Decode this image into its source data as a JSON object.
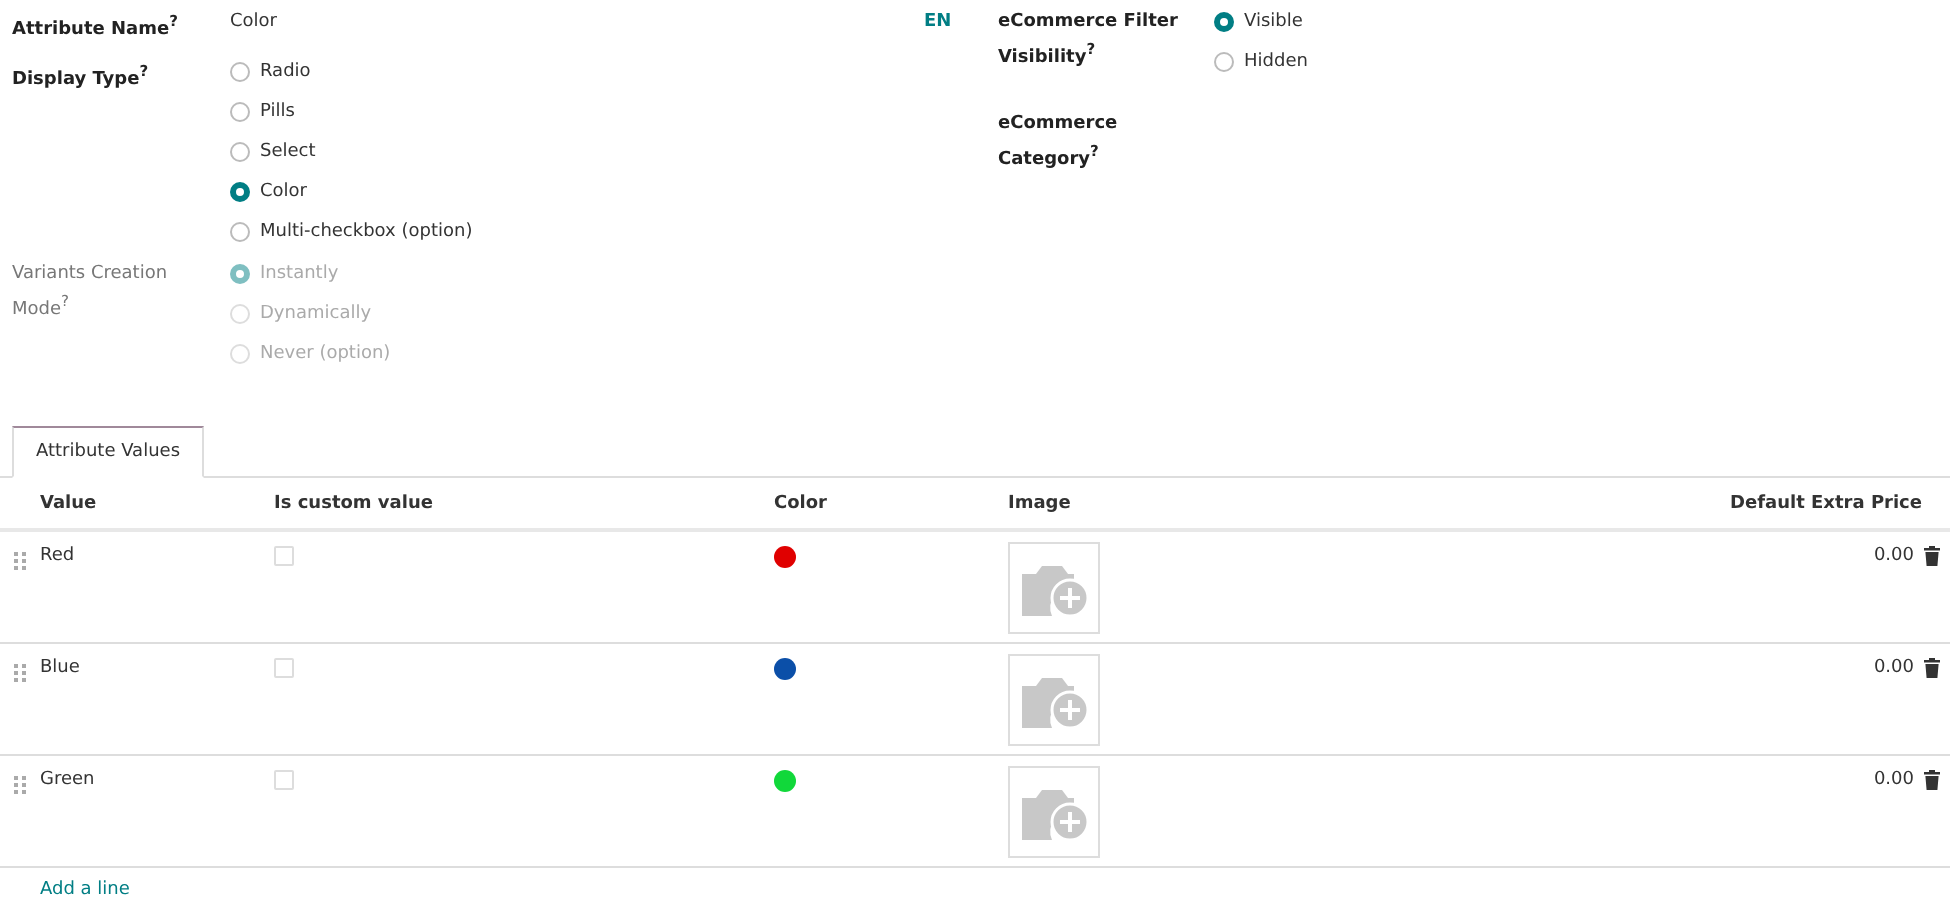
{
  "attribute_name": {
    "label": "Attribute Name$^{?}$",
    "value": "Color",
    "lang": "EN"
  },
  "display_type": {
    "label": "Display Type$^{?}$",
    "options": [
      {
        "label": "Radio",
        "selected": false
      },
      {
        "label": "Pills",
        "selected": false
      },
      {
        "label": "Select",
        "selected": false
      },
      {
        "label": "Color",
        "selected": true
      },
      {
        "label": "Multi-checkbox (option)",
        "selected": false
      }
    ]
  },
  "variants_mode": {
    "label": "Variants Creation Mode$^{?}$",
    "disabled": true,
    "options": [
      {
        "label": "Instantly",
        "selected": true
      },
      {
        "label": "Dynamically",
        "selected": false
      },
      {
        "label": "Never (option)",
        "selected": false
      }
    ]
  },
  "filter_visibility": {
    "label": "eCommerce Filter Visibility$^{?}$",
    "options": [
      {
        "label": "Visible",
        "selected": true
      },
      {
        "label": "Hidden",
        "selected": false
      }
    ]
  },
  "ecommerce_category": {
    "label": "eCommerce Category$^{?}$"
  },
  "tabs": [
    {
      "label": "Attribute Values",
      "selected": true
    }
  ],
  "table": {
    "columns": [
      "Value",
      "Is custom value",
      "Color",
      "Image",
      "Default Extra Price"
    ],
    "rows": [
      {
        "value": "Red",
        "custom": false,
        "color": "#e00000",
        "price": "0.00"
      },
      {
        "value": "Blue",
        "custom": false,
        "color": "#0b4fa8",
        "price": "0.00"
      },
      {
        "value": "Green",
        "custom": false,
        "color": "#11d83a",
        "price": "0.00"
      }
    ],
    "add_line": "Add a line"
  }
}
